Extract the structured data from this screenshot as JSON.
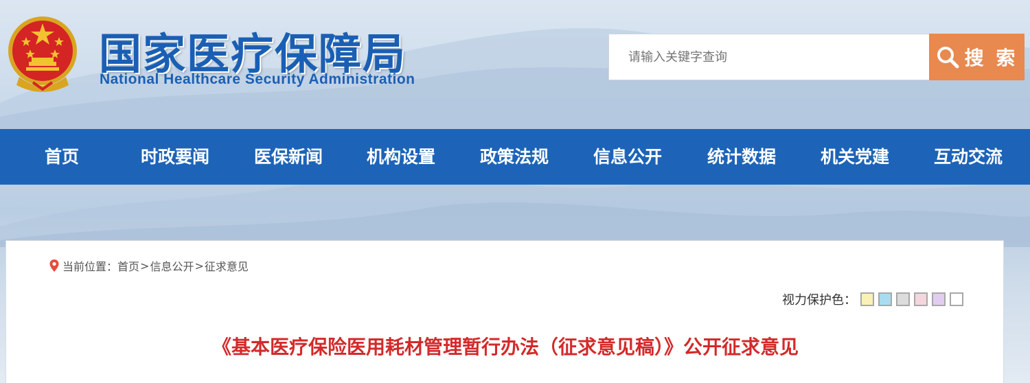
{
  "header": {
    "logo_cn": "国家医疗保障局",
    "logo_en": "National Healthcare Security Administration",
    "emblem_icon": "national-emblem-icon"
  },
  "search": {
    "placeholder": "请输入关键字查询",
    "button_label": "搜 索",
    "button_icon": "search-icon",
    "button_color": "#e8894f"
  },
  "nav": {
    "color": "#1d64b8",
    "items": [
      {
        "label": "首页"
      },
      {
        "label": "时政要闻"
      },
      {
        "label": "医保新闻"
      },
      {
        "label": "机构设置"
      },
      {
        "label": "政策法规"
      },
      {
        "label": "信息公开"
      },
      {
        "label": "统计数据"
      },
      {
        "label": "机关党建"
      },
      {
        "label": "互动交流"
      }
    ]
  },
  "breadcrumb": {
    "icon": "location-pin-icon",
    "prefix": "当前位置：",
    "items": [
      "首页",
      "信息公开",
      "征求意见"
    ],
    "separator": ">"
  },
  "vision": {
    "label": "视力保护色：",
    "swatches": [
      "#f9f1b6",
      "#a9dcf1",
      "#dcdcdc",
      "#f4d6dd",
      "#e2cdf0",
      "#ffffff"
    ]
  },
  "article": {
    "title": "《基本医疗保险医用耗材管理暂行办法（征求意见稿）》公开征求意见",
    "title_color": "#d32a2a"
  }
}
